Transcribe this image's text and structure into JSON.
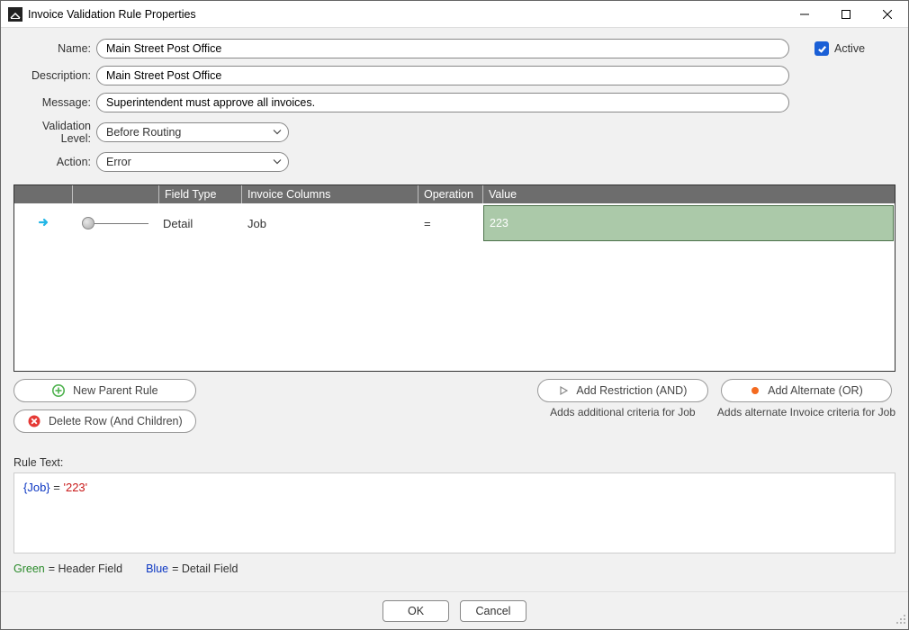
{
  "window": {
    "title": "Invoice Validation Rule Properties"
  },
  "form": {
    "name_label": "Name:",
    "name_value": "Main Street Post Office",
    "description_label": "Description:",
    "description_value": "Main Street Post Office",
    "message_label": "Message:",
    "message_value": "Superintendent must approve all invoices.",
    "validation_level_label": "Validation Level:",
    "validation_level_value": "Before Routing",
    "action_label": "Action:",
    "action_value": "Error",
    "active_label": "Active",
    "active_checked": true
  },
  "grid": {
    "headers": {
      "field_type": "Field Type",
      "invoice_columns": "Invoice Columns",
      "operation": "Operation",
      "value": "Value"
    },
    "rows": [
      {
        "field_type": "Detail",
        "invoice_column": "Job",
        "operation": "=",
        "value": "223"
      }
    ]
  },
  "buttons": {
    "new_parent_rule": "New Parent Rule",
    "delete_row": "Delete Row (And Children)",
    "add_restriction": "Add Restriction (AND)",
    "add_restriction_caption": "Adds additional criteria for Job",
    "add_alternate": "Add Alternate (OR)",
    "add_alternate_caption": "Adds alternate Invoice criteria for Job"
  },
  "rule_text": {
    "label": "Rule Text:",
    "field_token": "{Job}",
    "operator_token": " = ",
    "value_token": "'223'"
  },
  "legend": {
    "green_label": "Green",
    "green_desc": "=  Header Field",
    "blue_label": "Blue",
    "blue_desc": "=  Detail Field"
  },
  "footer": {
    "ok": "OK",
    "cancel": "Cancel"
  }
}
